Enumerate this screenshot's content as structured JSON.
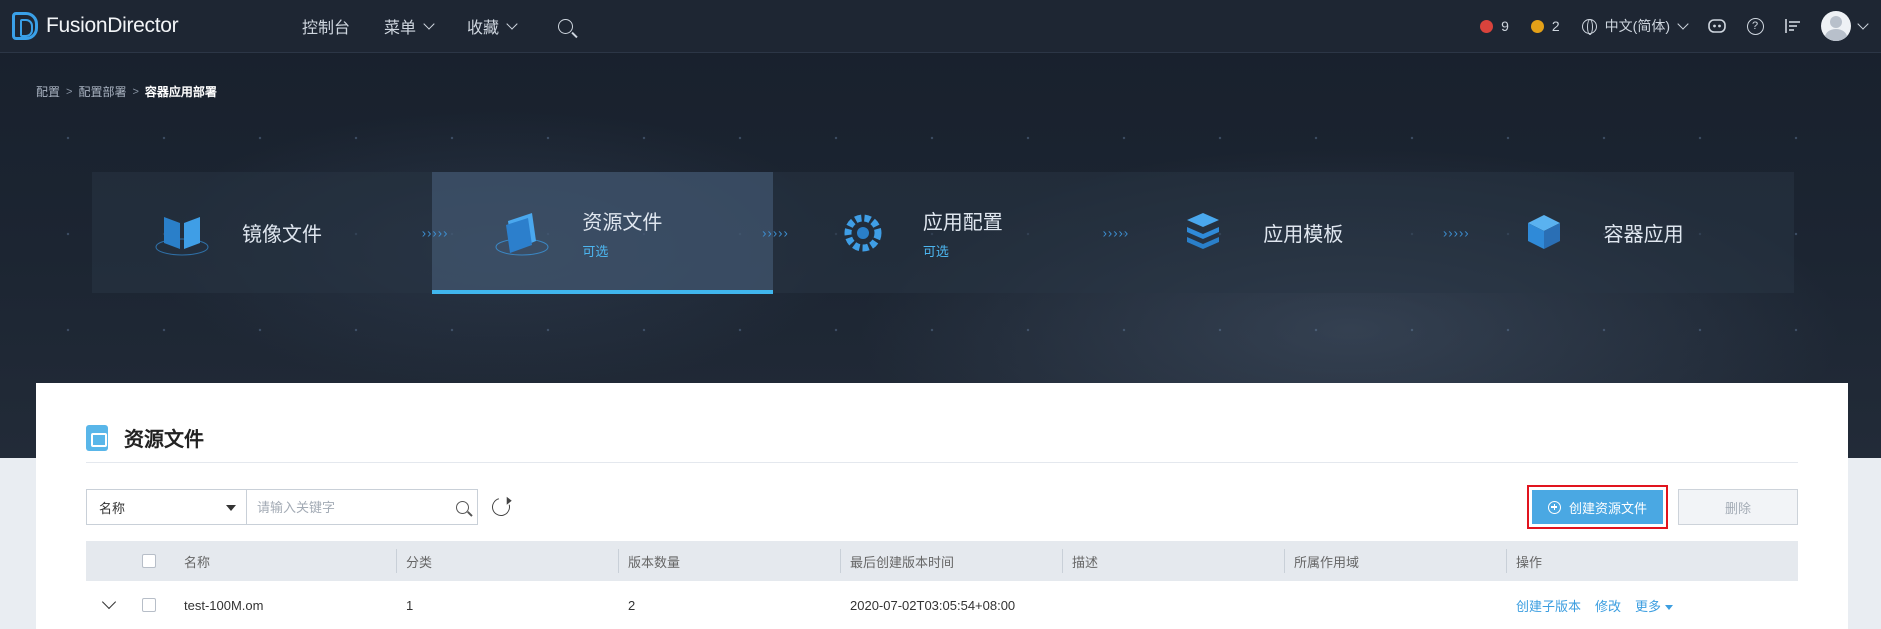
{
  "app": {
    "name": "FusionDirector"
  },
  "nav": {
    "items": [
      "控制台",
      "菜单",
      "收藏"
    ]
  },
  "alarms": {
    "critical": "9",
    "major": "2"
  },
  "colors": {
    "critical": "#d9433c",
    "major": "#e3a018",
    "accent": "#40b6ee",
    "primary_button": "#4aa8e3"
  },
  "language": "中文(简体)",
  "breadcrumb": [
    "配置",
    "配置部署",
    "容器应用部署"
  ],
  "steps": [
    {
      "title": "镜像文件",
      "sub": "",
      "icon": "mirror-file-icon"
    },
    {
      "title": "资源文件",
      "sub": "可选",
      "icon": "resource-folder-icon",
      "active": true
    },
    {
      "title": "应用配置",
      "sub": "可选",
      "icon": "gear-icon"
    },
    {
      "title": "应用模板",
      "sub": "",
      "icon": "stack-layers-icon"
    },
    {
      "title": "容器应用",
      "sub": "",
      "icon": "cube-icon"
    }
  ],
  "card": {
    "title": "资源文件"
  },
  "filter": {
    "field": "名称",
    "placeholder": "请输入关键字"
  },
  "buttons": {
    "create": "创建资源文件",
    "delete": "删除"
  },
  "table": {
    "columns": [
      "名称",
      "分类",
      "版本数量",
      "最后创建版本时间",
      "描述",
      "所属作用域",
      "操作"
    ],
    "rows": [
      {
        "name": "test-100M.om",
        "category": "1",
        "versions": "2",
        "last_created": "2020-07-02T03:05:54+08:00",
        "description": "",
        "scope": "",
        "actions": [
          "创建子版本",
          "修改",
          "更多"
        ]
      }
    ]
  }
}
